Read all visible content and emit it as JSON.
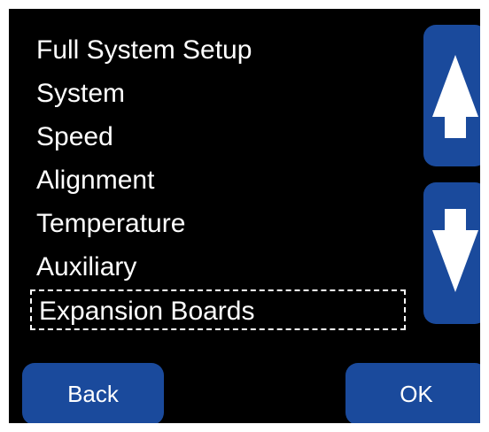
{
  "menu": {
    "items": [
      {
        "label": "Full System Setup"
      },
      {
        "label": "System"
      },
      {
        "label": "Speed"
      },
      {
        "label": "Alignment"
      },
      {
        "label": "Temperature"
      },
      {
        "label": "Auxiliary"
      },
      {
        "label": "Expansion Boards",
        "selected": true
      }
    ]
  },
  "scroll": {
    "up_icon": "arrow-up-icon",
    "down_icon": "arrow-down-icon"
  },
  "buttons": {
    "back_label": "Back",
    "ok_label": "OK"
  },
  "colors": {
    "screen_background": "#000000",
    "button_fill": "#1a4a9c",
    "text": "#ffffff"
  }
}
